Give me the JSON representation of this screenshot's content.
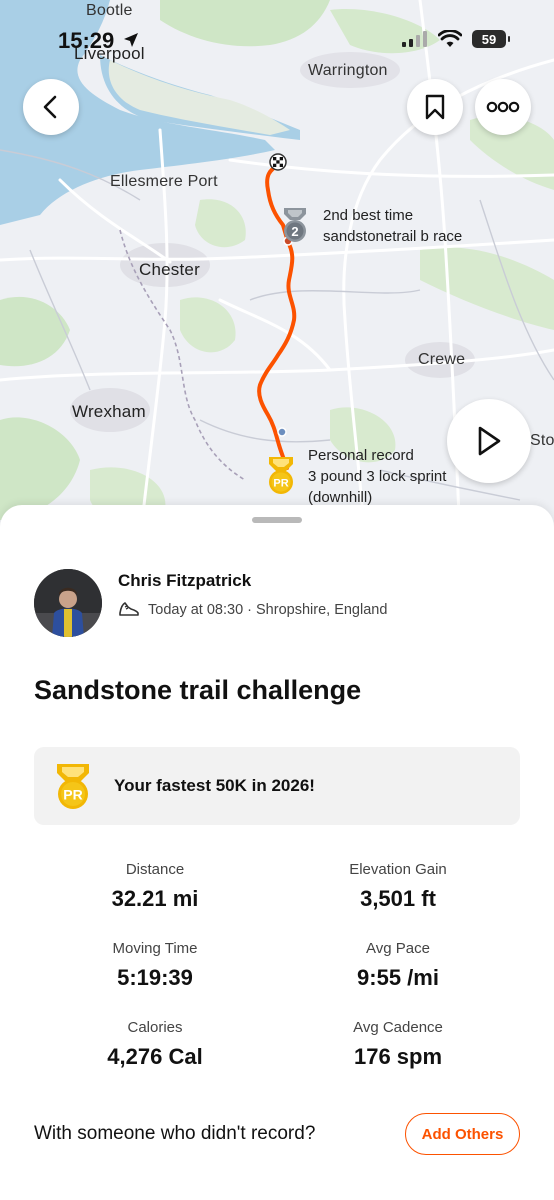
{
  "status_bar": {
    "time": "15:29",
    "battery": "59"
  },
  "map": {
    "places": {
      "bootle": "Bootle",
      "liverpool": "Liverpool",
      "warrington": "Warrington",
      "ellesmere_port": "Ellesmere Port",
      "chester": "Chester",
      "crewe": "Crewe",
      "wrexham": "Wrexham",
      "sto": "Sto"
    },
    "segment_top": {
      "rank": "2",
      "line1": "2nd best time",
      "line2": "sandstonetrail b race"
    },
    "segment_bottom": {
      "badge": "PR",
      "line1": "Personal record",
      "line2": "3 pound 3 lock sprint",
      "line3": "(downhill)"
    },
    "route_color": "#fc5200"
  },
  "activity": {
    "athlete_name": "Chris Fitzpatrick",
    "meta": "Today at 08:30 · Shropshire, England",
    "title": "Sandstone trail challenge",
    "pr_badge": "PR",
    "pr_text": "Your fastest 50K in 2026!",
    "stats": [
      {
        "label": "Distance",
        "value": "32.21 mi"
      },
      {
        "label": "Elevation Gain",
        "value": "3,501 ft"
      },
      {
        "label": "Moving Time",
        "value": "5:19:39"
      },
      {
        "label": "Avg Pace",
        "value": "9:55 /mi"
      },
      {
        "label": "Calories",
        "value": "4,276 Cal"
      },
      {
        "label": "Avg Cadence",
        "value": "176 spm"
      }
    ],
    "with_others_text": "With someone who didn't record?",
    "add_others_label": "Add Others"
  },
  "colors": {
    "accent": "#fc5200",
    "pr_gold": "#f5c518"
  }
}
